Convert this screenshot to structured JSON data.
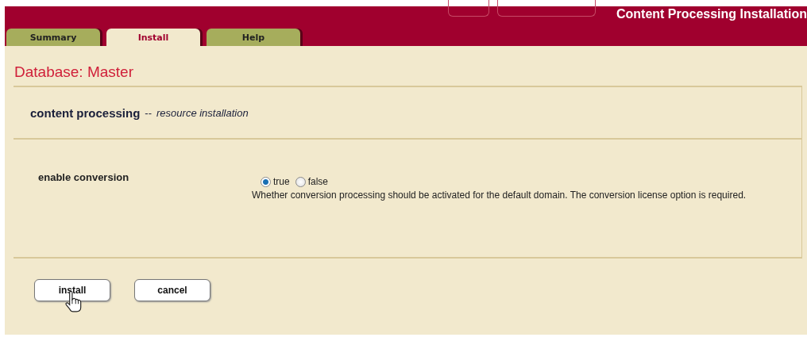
{
  "header": {
    "title": "Content Processing Installation"
  },
  "tabs": [
    {
      "label": "Summary",
      "selected": false
    },
    {
      "label": "Install",
      "selected": true
    },
    {
      "label": "Help",
      "selected": false
    }
  ],
  "page_title": "Database: Master",
  "section": {
    "title": "content processing",
    "separator": "--",
    "subtitle": "resource installation"
  },
  "settings": [
    {
      "label": "enable conversion",
      "kind": "radio",
      "options": [
        {
          "label": "true",
          "selected": true
        },
        {
          "label": "false",
          "selected": false
        }
      ],
      "description": "Whether conversion processing should be activated for the default domain. The conversion license option is required."
    }
  ],
  "buttons": [
    {
      "label": "install",
      "hovered": true
    },
    {
      "label": "cancel",
      "hovered": false
    }
  ]
}
